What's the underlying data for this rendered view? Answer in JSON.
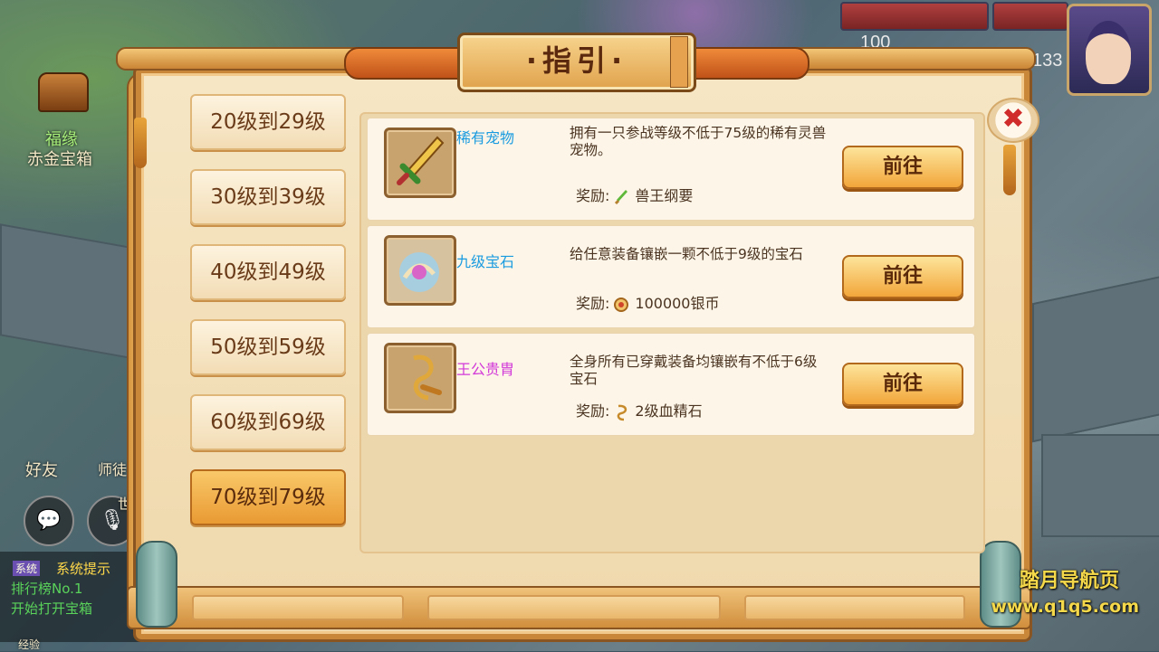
{
  "dialog": {
    "title": "·指引·",
    "close_symbol": "✖"
  },
  "tabs": [
    {
      "label": "20级到29级",
      "active": false
    },
    {
      "label": "30级到39级",
      "active": false
    },
    {
      "label": "40级到49级",
      "active": false
    },
    {
      "label": "50级到59级",
      "active": false
    },
    {
      "label": "60级到69级",
      "active": false
    },
    {
      "label": "70级到79级",
      "active": true
    }
  ],
  "guides": [
    {
      "name": "稀有宠物",
      "name_color": "#1a9be0",
      "icon": "sword-icon",
      "description": "拥有一只参战等级不低于75级的稀有灵兽宠物。",
      "reward_label": "奖励:",
      "reward_icon": "sword-small-icon",
      "reward": "兽王纲要",
      "button": "前往"
    },
    {
      "name": "九级宝石",
      "name_color": "#1a9be0",
      "icon": "gem-icon",
      "description": "给任意装备镶嵌一颗不低于9级的宝石",
      "reward_label": "奖励:",
      "reward_icon": "silver-coin-icon",
      "reward": "100000银币",
      "button": "前往"
    },
    {
      "name": "王公贵胄",
      "name_color": "#d238d8",
      "icon": "whip-icon",
      "description": "全身所有已穿戴装备均镶嵌有不低于6级宝石",
      "reward_label": "奖励:",
      "reward_icon": "whip-small-icon",
      "reward": "2级血精石",
      "button": "前往"
    }
  ],
  "background": {
    "chest_label_1": "福缘",
    "chest_label_2": "赤金宝箱",
    "friends_label": "好友",
    "master_label": "师徒",
    "world_label": "世",
    "chat_tag": "系统",
    "chat_line1": "系统提示",
    "chat_line2": "排行榜No.1",
    "chat_line3": "开始打开宝箱",
    "hp_value_1": "100",
    "hp_value_2": "133",
    "exp_label": "经验"
  },
  "watermark": {
    "line1": "踏月导航页",
    "line2": "www.q1q5.com"
  }
}
